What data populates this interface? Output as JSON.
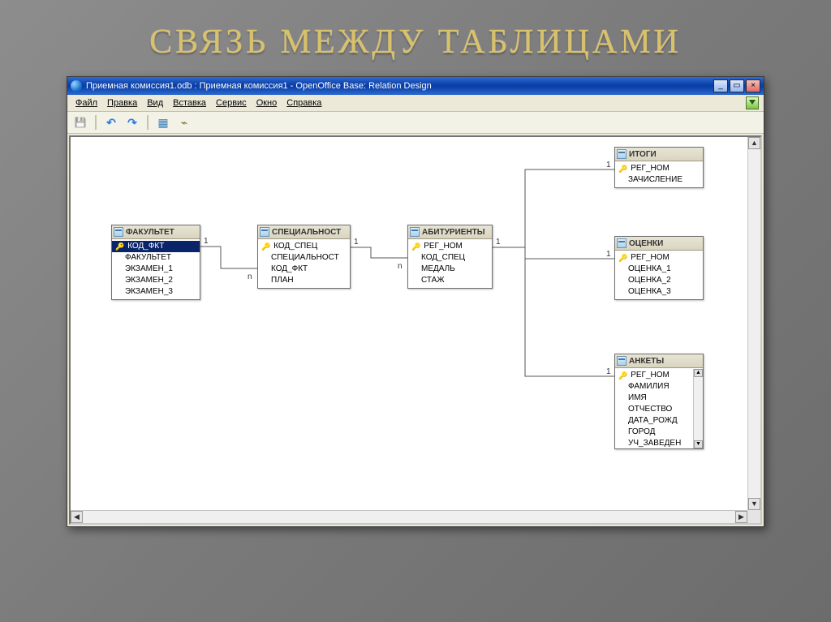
{
  "slide": {
    "title": "СВЯЗЬ МЕЖДУ ТАБЛИЦАМИ"
  },
  "window": {
    "title": "Приемная комиссия1.odb : Приемная комиссия1 - OpenOffice Base: Relation Design",
    "min": "_",
    "max": "▭",
    "close": "×"
  },
  "menu": {
    "file": "Файл",
    "edit": "Правка",
    "view": "Вид",
    "insert": "Вставка",
    "tools": "Сервис",
    "window": "Окно",
    "help": "Справка"
  },
  "tables": {
    "fakultet": {
      "title": "ФАКУЛЬТЕТ",
      "f0": "КОД_ФКТ",
      "f1": "ФАКУЛЬТЕТ",
      "f2": "ЭКЗАМЕН_1",
      "f3": "ЭКЗАМЕН_2",
      "f4": "ЭКЗАМЕН_3"
    },
    "spec": {
      "title": "СПЕЦИАЛЬНОСТ",
      "f0": "КОД_СПЕЦ",
      "f1": "СПЕЦИАЛЬНОСТ",
      "f2": "КОД_ФКТ",
      "f3": "ПЛАН"
    },
    "abitur": {
      "title": "АБИТУРИЕНТЫ",
      "f0": "РЕГ_НОМ",
      "f1": "КОД_СПЕЦ",
      "f2": "МЕДАЛЬ",
      "f3": "СТАЖ"
    },
    "itogi": {
      "title": "ИТОГИ",
      "f0": "РЕГ_НОМ",
      "f1": "ЗАЧИСЛЕНИЕ"
    },
    "ocenki": {
      "title": "ОЦЕНКИ",
      "f0": "РЕГ_НОМ",
      "f1": "ОЦЕНКА_1",
      "f2": "ОЦЕНКА_2",
      "f3": "ОЦЕНКА_3"
    },
    "ankety": {
      "title": "АНКЕТЫ",
      "f0": "РЕГ_НОМ",
      "f1": "ФАМИЛИЯ",
      "f2": "ИМЯ",
      "f3": "ОТЧЕСТВО",
      "f4": "ДАТА_РОЖД",
      "f5": "ГОРОД",
      "f6": "УЧ_ЗАВЕДЕН"
    }
  },
  "rel_labels": {
    "one": "1",
    "many": "n"
  }
}
